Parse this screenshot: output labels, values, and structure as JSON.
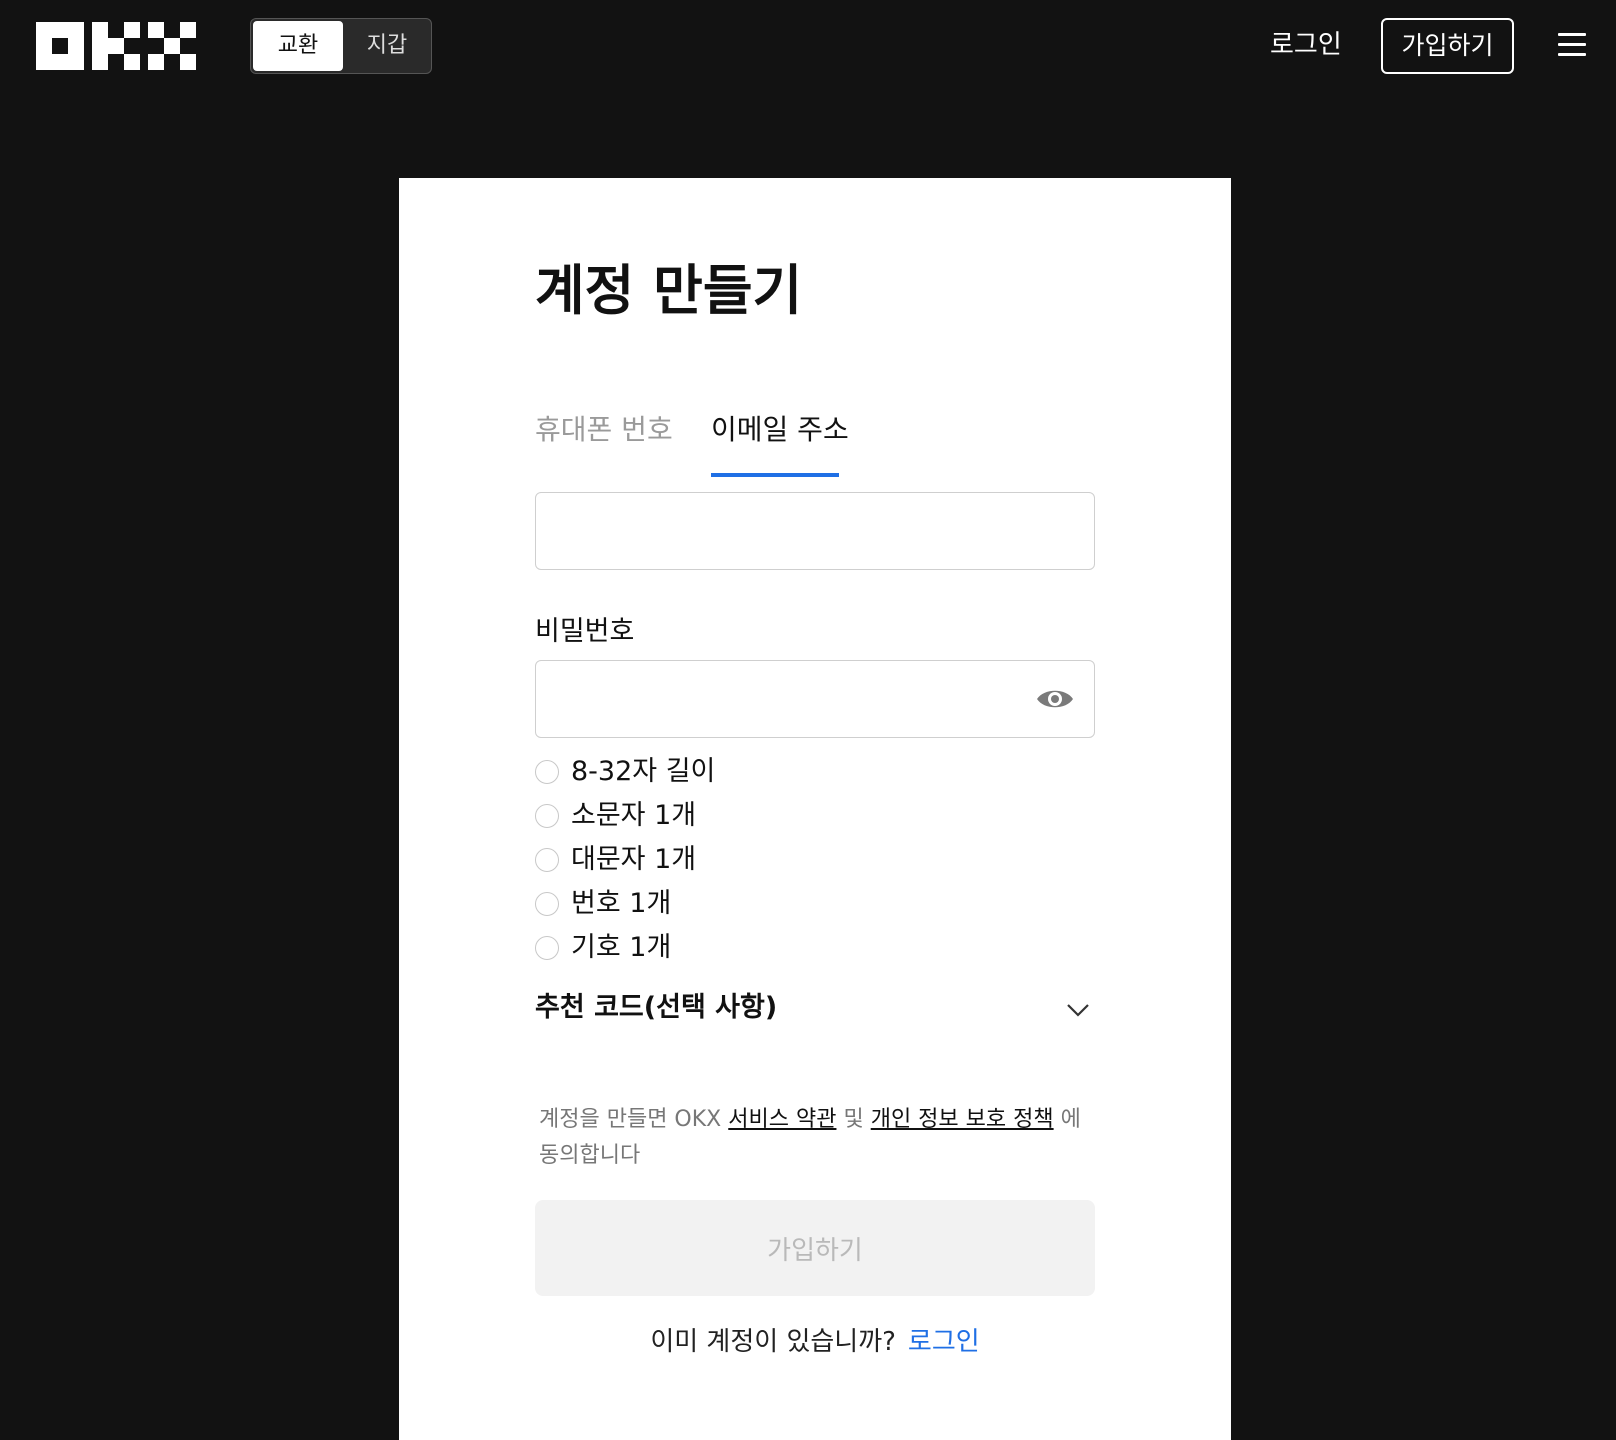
{
  "header": {
    "logo_text": "OKX",
    "mode_switch": {
      "exchange_label": "교환",
      "wallet_label": "지갑",
      "active": "exchange"
    },
    "login_label": "로그인",
    "signup_label": "가입하기"
  },
  "form": {
    "title": "계정 만들기",
    "tabs": [
      {
        "label": "휴대폰 번호",
        "active": false
      },
      {
        "label": "이메일 주소",
        "active": true
      }
    ],
    "email_value": "",
    "password_label": "비밀번호",
    "password_value": "",
    "password_rules": [
      "8-32자 길이",
      "소문자 1개",
      "대문자 1개",
      "번호 1개",
      "기호 1개"
    ],
    "referral_label": "추천 코드(선택 사항)",
    "terms": {
      "prefix": "계정을 만들면 OKX",
      "terms_link": "서비스 약관",
      "conj": "및",
      "privacy_link": "개인 정보 보호 정책",
      "suffix": "에 동의합니다"
    },
    "submit_label": "가입하기",
    "existing_prompt": "이미 계정이 있습니까?",
    "existing_login": "로그인"
  },
  "colors": {
    "background": "#121212",
    "accent": "#1f6fe5",
    "card": "#ffffff",
    "disabled_button": "#f2f2f2"
  }
}
